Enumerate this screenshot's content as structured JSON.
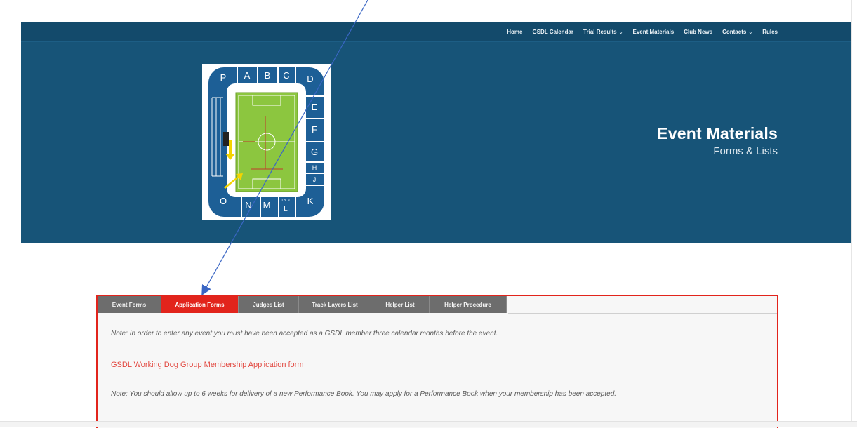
{
  "nav": {
    "items": [
      {
        "label": "Home",
        "has_dropdown": false
      },
      {
        "label": "GSDL Calendar",
        "has_dropdown": false
      },
      {
        "label": "Trial Results",
        "has_dropdown": true
      },
      {
        "label": "Event Materials",
        "has_dropdown": false
      },
      {
        "label": "Club News",
        "has_dropdown": false
      },
      {
        "label": "Contacts",
        "has_dropdown": true
      },
      {
        "label": "Rules",
        "has_dropdown": false
      }
    ]
  },
  "hero": {
    "title": "Event Materials",
    "subtitle": "Forms & Lists",
    "background_color": "#175478"
  },
  "logo": {
    "sections": {
      "top": [
        "P",
        "A",
        "B",
        "C",
        "D"
      ],
      "right": [
        "E",
        "F",
        "G",
        "H",
        "J",
        "K"
      ],
      "bottom": [
        "O",
        "N",
        "M",
        "L"
      ],
      "small_label": "L8L9"
    },
    "stand_color": "#1d5f96",
    "pitch_color": "#8cc63f"
  },
  "tabs": {
    "items": [
      {
        "label": "Event Forms",
        "active": false
      },
      {
        "label": "Application Forms",
        "active": true
      },
      {
        "label": "Judges List",
        "active": false
      },
      {
        "label": "Track Layers List",
        "active": false
      },
      {
        "label": "Helper List",
        "active": false
      },
      {
        "label": "Helper Procedure",
        "active": false
      }
    ],
    "accent_color": "#e2241c"
  },
  "content": {
    "note1": "Note: In order to enter any event you must have been accepted as a GSDL member three calendar months before the event.",
    "link": "GSDL Working Dog Group Membership Application form",
    "note2": "Note: You should allow up to 6 weeks for delivery of a new Performance Book.  You may apply for a Performance Book when your membership has been accepted."
  }
}
